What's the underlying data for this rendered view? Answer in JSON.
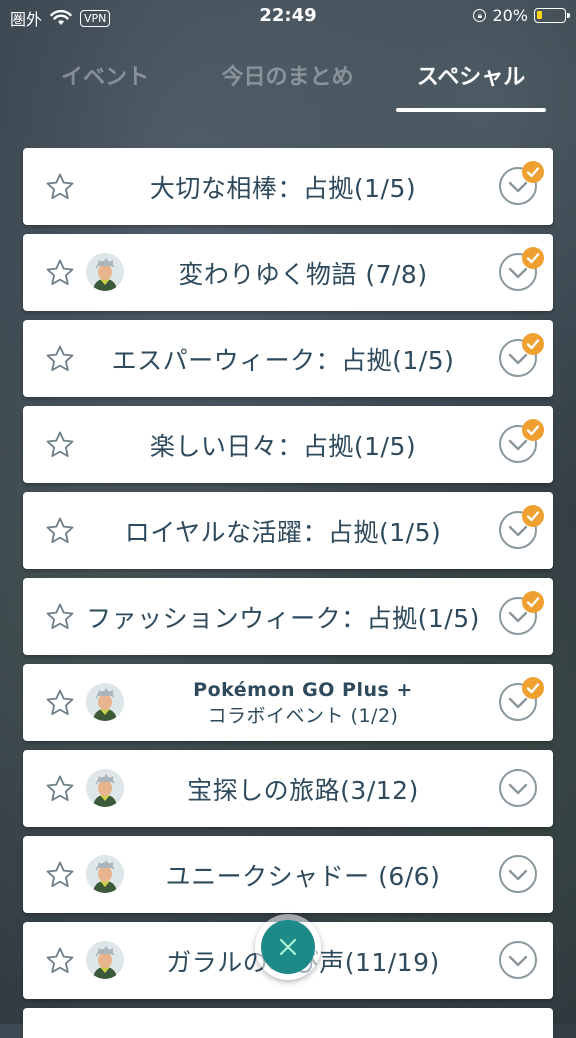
{
  "status_bar": {
    "carrier": "圏外",
    "vpn": "VPN",
    "time": "22:49",
    "battery": "20%",
    "battery_level": 0.2
  },
  "tabs": [
    {
      "label": "イベント",
      "active": false
    },
    {
      "label": "今日のまとめ",
      "active": false
    },
    {
      "label": "スペシャル",
      "active": true
    }
  ],
  "research_list": [
    {
      "title": "大切な相棒：占拠(1/5)",
      "avatar": false,
      "badge": true
    },
    {
      "title": "変わりゆく物語 (7/8)",
      "avatar": true,
      "badge": true
    },
    {
      "title": "エスパーウィーク：占拠(1/5)",
      "avatar": false,
      "badge": true
    },
    {
      "title": "楽しい日々：占拠(1/5)",
      "avatar": false,
      "badge": true
    },
    {
      "title": "ロイヤルな活躍：占拠(1/5)",
      "avatar": false,
      "badge": true
    },
    {
      "title": "ファッションウィーク：占拠(1/5)",
      "avatar": false,
      "badge": true
    },
    {
      "title": "Pokémon GO Plus +",
      "subtitle": "コラボイベント (1/2)",
      "avatar": true,
      "badge": true
    },
    {
      "title": "宝探しの旅路(3/12)",
      "avatar": true,
      "badge": false
    },
    {
      "title": "ユニークシャドー (6/6)",
      "avatar": true,
      "badge": false
    },
    {
      "title": "ガラルの叫び声(11/19)",
      "avatar": true,
      "badge": false
    }
  ],
  "colors": {
    "title_text": "#2e4a5c",
    "badge": "#f0a030",
    "close_button": "#1e8a88"
  },
  "icons": {
    "star": "star-outline-icon",
    "check": "chevron-check-circle-icon",
    "close": "close-icon"
  }
}
